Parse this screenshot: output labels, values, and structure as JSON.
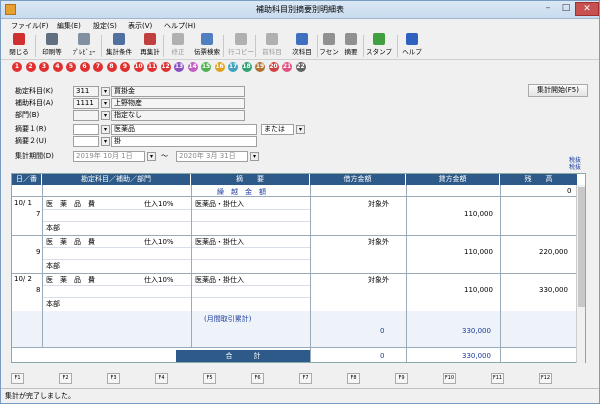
{
  "window": {
    "title": "補助科目別摘要別明細表"
  },
  "menu": [
    "ファイル(F)",
    "編集(E)",
    "設定(S)",
    "表示(V)",
    "ヘルプ(H)"
  ],
  "toolbar": [
    {
      "label": "閉じる",
      "color": "#d03030",
      "enabled": true
    },
    {
      "label": "印刷等",
      "color": "#607080",
      "enabled": true
    },
    {
      "label": "ﾌﾟﾚﾋﾞｭｰ",
      "color": "#8090a0",
      "enabled": true
    },
    {
      "label": "集計条件",
      "color": "#5070a0",
      "enabled": true
    },
    {
      "label": "再集計",
      "color": "#c04040",
      "enabled": true
    },
    {
      "label": "修正",
      "color": "#b0b0b0",
      "enabled": false
    },
    {
      "label": "伝票検索",
      "color": "#5080c0",
      "enabled": true
    },
    {
      "label": "行コピー",
      "color": "#b0b0b0",
      "enabled": false
    },
    {
      "label": "前科目",
      "color": "#b0b0b0",
      "enabled": false
    },
    {
      "label": "次科目",
      "color": "#4070c0",
      "enabled": true
    },
    {
      "label": "フセン",
      "color": "#909090",
      "enabled": true
    },
    {
      "label": "摘要",
      "color": "#909090",
      "enabled": true
    },
    {
      "label": "スタンプ",
      "color": "#40a040",
      "enabled": true
    },
    {
      "label": "ヘルプ",
      "color": "#3060c0",
      "enabled": true
    }
  ],
  "number_buttons": [
    "1",
    "2",
    "3",
    "4",
    "5",
    "6",
    "7",
    "8",
    "9",
    "10",
    "11",
    "12",
    "13",
    "14",
    "15",
    "16",
    "17",
    "18",
    "19",
    "20",
    "21",
    "22"
  ],
  "number_colors": [
    "#e03030",
    "#e03030",
    "#e03030",
    "#e03030",
    "#e03030",
    "#e03030",
    "#e03030",
    "#e03030",
    "#e03030",
    "#e03030",
    "#e03030",
    "#e03030",
    "#8a4fc0",
    "#c060c0",
    "#50b050",
    "#e0a020",
    "#40a0c0",
    "#30a070",
    "#b07030",
    "#d04040",
    "#e05080",
    "#606060"
  ],
  "form": {
    "account_label": "勘定科目(K)",
    "account_code": "311",
    "account_name": "買掛金",
    "sub_label": "補助科目(A)",
    "sub_code": "1111",
    "sub_name": "上野物産",
    "dept_label": "部門(B)",
    "dept_name": "指定なし",
    "memo1_label": "摘要１(R)",
    "memo1_value": "医薬品",
    "memo2_label": "摘要２(U)",
    "memo2_value": "掛",
    "logic": "または",
    "period_label": "集計期間(D)",
    "from_date": "2019年 10月  1日",
    "to_date": "2020年  3月 31日",
    "tilde": "～",
    "start_button": "集計開始(F5)",
    "tax_mode": "税抜\n税抜"
  },
  "grid": {
    "headers": [
      "日／番",
      "勘定科目／補助／部門",
      "摘　　要",
      "借方金額",
      "貸方金額",
      "残　　高"
    ],
    "carry": {
      "label": "繰　越　金　額",
      "balance": "0"
    },
    "rows": [
      {
        "date": "10/ 1",
        "no": "7",
        "account": "医　薬　品　費",
        "tax": "仕入10%",
        "dept": "本部",
        "memo": "医薬品・掛仕入",
        "debit_note": "対象外",
        "credit": "110,000",
        "balance": ""
      },
      {
        "date": "",
        "no": "9",
        "account": "医　薬　品　費",
        "tax": "仕入10%",
        "dept": "本部",
        "memo": "医薬品・掛仕入",
        "debit_note": "対象外",
        "credit": "110,000",
        "balance": "220,000"
      },
      {
        "date": "10/ 2",
        "no": "8",
        "account": "医　薬　品　費",
        "tax": "仕入10%",
        "dept": "本部",
        "memo": "医薬品・掛仕入",
        "debit_note": "対象外",
        "credit": "110,000",
        "balance": "330,000"
      }
    ],
    "monthly": {
      "label": "(月間取引累計)",
      "debit": "0",
      "credit": "330,000"
    },
    "total": {
      "label": "合　　　計",
      "debit": "0",
      "credit": "330,000"
    }
  },
  "fkeys": [
    "F1",
    "F2",
    "F3",
    "F4",
    "F5",
    "F6",
    "F7",
    "F8",
    "F9",
    "F10",
    "F11",
    "F12"
  ],
  "status": "集計が完了しました。"
}
